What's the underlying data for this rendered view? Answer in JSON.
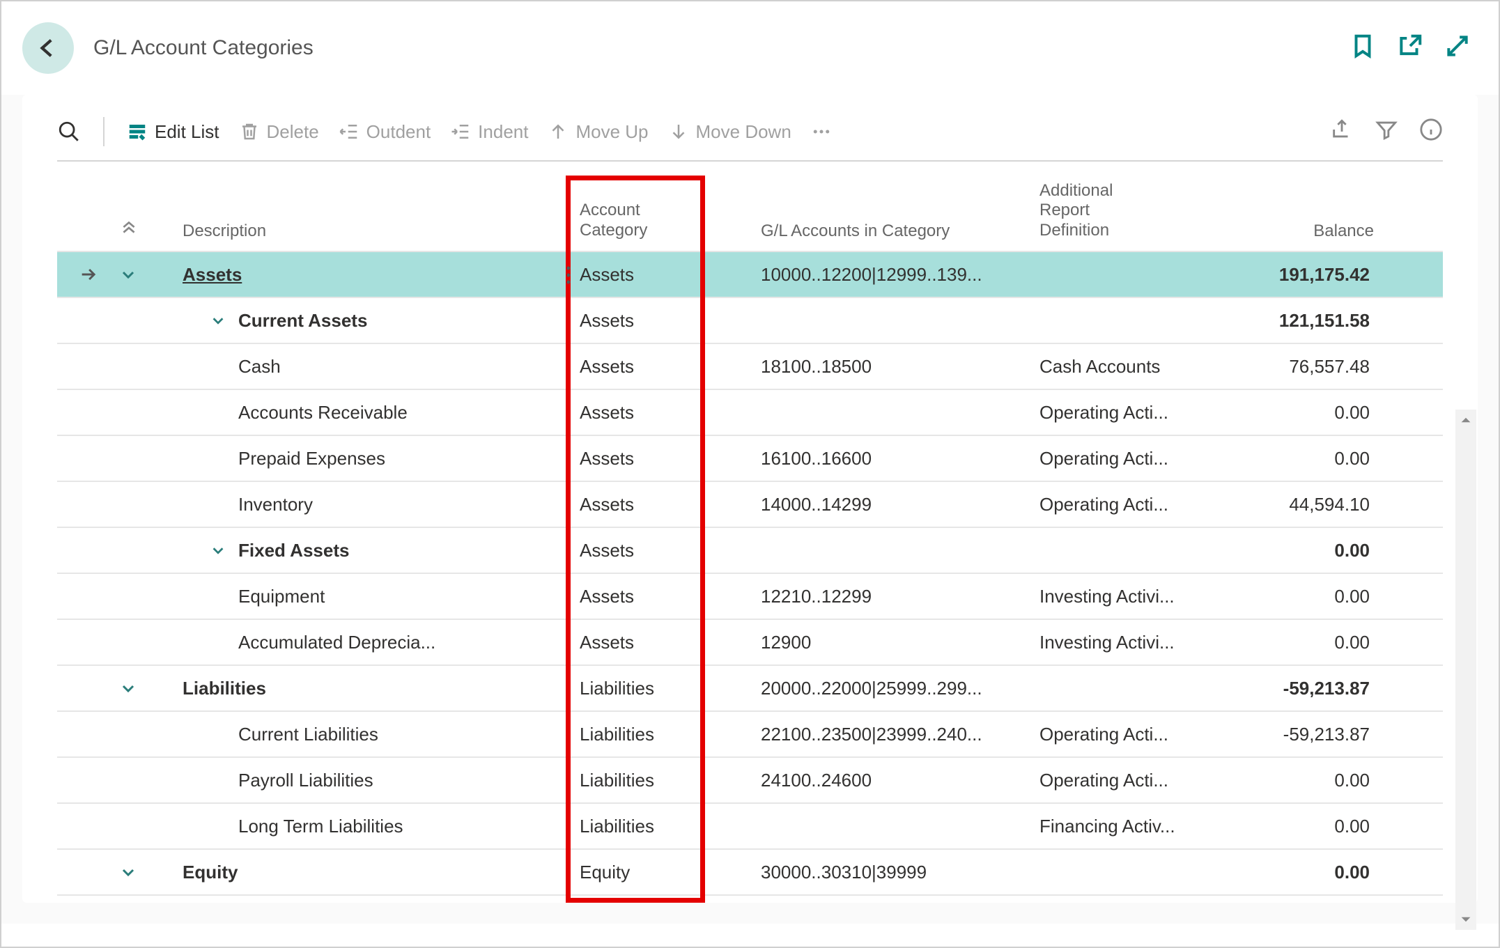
{
  "title": "G/L Account Categories",
  "toolbar": {
    "edit_list": "Edit List",
    "delete": "Delete",
    "outdent": "Outdent",
    "indent": "Indent",
    "move_up": "Move Up",
    "move_down": "Move Down"
  },
  "columns": {
    "description": "Description",
    "account_category": "Account Category",
    "gl_accounts": "G/L Accounts in Category",
    "additional_report": "Additional Report Definition",
    "balance": "Balance"
  },
  "rows": [
    {
      "indent": 1,
      "expander": true,
      "bold": true,
      "underline": true,
      "selected": true,
      "selector": true,
      "description": "Assets",
      "category": "Assets",
      "gl": "10000..12200|12999..139...",
      "report": "",
      "balance": "191,175.42"
    },
    {
      "indent": 2,
      "expander": true,
      "bold": true,
      "description": "Current Assets",
      "category": "Assets",
      "gl": "",
      "report": "",
      "balance": "121,151.58"
    },
    {
      "indent": 3,
      "description": "Cash",
      "category": "Assets",
      "gl": "18100..18500",
      "report": "Cash Accounts",
      "balance": "76,557.48"
    },
    {
      "indent": 3,
      "description": "Accounts Receivable",
      "category": "Assets",
      "gl": "",
      "report": "Operating Acti...",
      "balance": "0.00"
    },
    {
      "indent": 3,
      "description": "Prepaid Expenses",
      "category": "Assets",
      "gl": "16100..16600",
      "report": "Operating Acti...",
      "balance": "0.00"
    },
    {
      "indent": 3,
      "description": "Inventory",
      "category": "Assets",
      "gl": "14000..14299",
      "report": "Operating Acti...",
      "balance": "44,594.10"
    },
    {
      "indent": 2,
      "expander": true,
      "bold": true,
      "description": "Fixed Assets",
      "category": "Assets",
      "gl": "",
      "report": "",
      "balance": "0.00"
    },
    {
      "indent": 3,
      "description": "Equipment",
      "category": "Assets",
      "gl": "12210..12299",
      "report": "Investing Activi...",
      "balance": "0.00"
    },
    {
      "indent": 3,
      "description": "Accumulated Deprecia...",
      "category": "Assets",
      "gl": "12900",
      "report": "Investing Activi...",
      "balance": "0.00"
    },
    {
      "indent": 1,
      "expander": true,
      "bold": true,
      "description": "Liabilities",
      "category": "Liabilities",
      "gl": "20000..22000|25999..299...",
      "report": "",
      "balance": "-59,213.87"
    },
    {
      "indent": 3,
      "description": "Current Liabilities",
      "category": "Liabilities",
      "gl": "22100..23500|23999..240...",
      "report": "Operating Acti...",
      "balance": "-59,213.87"
    },
    {
      "indent": 3,
      "description": "Payroll Liabilities",
      "category": "Liabilities",
      "gl": "24100..24600",
      "report": "Operating Acti...",
      "balance": "0.00"
    },
    {
      "indent": 3,
      "description": "Long Term Liabilities",
      "category": "Liabilities",
      "gl": "",
      "report": "Financing Activ...",
      "balance": "0.00"
    },
    {
      "indent": 1,
      "expander": true,
      "bold": true,
      "description": "Equity",
      "category": "Equity",
      "gl": "30000..30310|39999",
      "report": "",
      "balance": "0.00"
    }
  ],
  "highlight_column": "account_category"
}
